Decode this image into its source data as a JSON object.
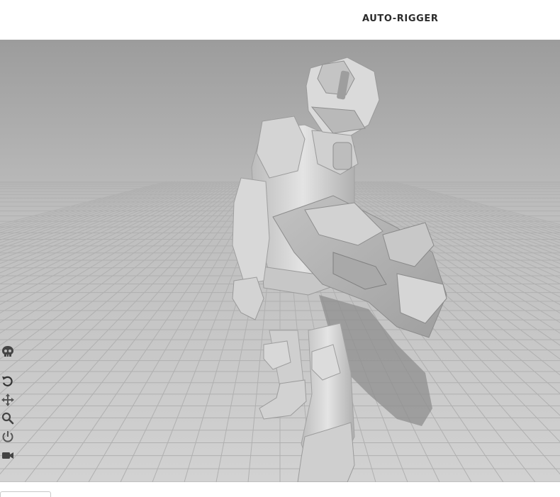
{
  "header": {
    "title": "AUTO-RIGGER"
  },
  "viewport": {
    "description_model": "armored-soldier-model",
    "background_top_color": "#9d9d9d",
    "floor_color": "#c9c9c9",
    "grid_line_color": "#b4b4b4",
    "model_color": "#d6d6d6"
  },
  "toolbar": {
    "tools": [
      {
        "name": "skeleton-icon"
      },
      {
        "name": "reset-rotation-icon"
      },
      {
        "name": "pan-move-icon"
      },
      {
        "name": "zoom-icon"
      },
      {
        "name": "power-icon"
      },
      {
        "name": "camera-icon"
      }
    ]
  }
}
